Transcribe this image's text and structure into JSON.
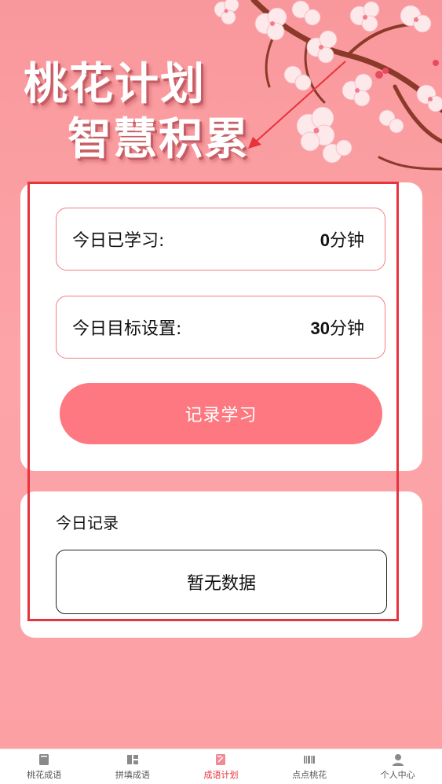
{
  "hero": {
    "line1": "桃花计划",
    "line2": "智慧积累"
  },
  "stats": {
    "studied_label": "今日已学习:",
    "studied_value": "0",
    "studied_unit": "分钟",
    "goal_label": "今日目标设置:",
    "goal_value": "30",
    "goal_unit": "分钟"
  },
  "actions": {
    "record_label": "记录学习"
  },
  "records": {
    "title": "今日记录",
    "empty_text": "暂无数据"
  },
  "tabbar": {
    "items": [
      {
        "label": "桃花成语",
        "icon": "book-icon",
        "active": false
      },
      {
        "label": "拼填成语",
        "icon": "puzzle-icon",
        "active": false
      },
      {
        "label": "成语计划",
        "icon": "plan-icon",
        "active": true
      },
      {
        "label": "点点桃花",
        "icon": "barcode-icon",
        "active": false
      },
      {
        "label": "个人中心",
        "icon": "person-icon",
        "active": false
      }
    ]
  },
  "colors": {
    "background": "#fba0a4",
    "accent": "#fd7880",
    "annotation": "#e8323c",
    "active_tab": "#e8323c"
  }
}
